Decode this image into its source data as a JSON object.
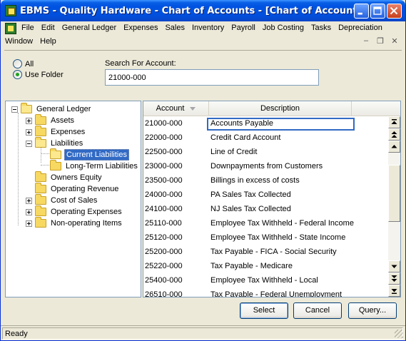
{
  "window": {
    "title": "EBMS - Quality Hardware - Chart of Accounts - [Chart of Accounts]"
  },
  "menu": {
    "row1": [
      "File",
      "Edit",
      "General Ledger",
      "Expenses",
      "Sales",
      "Inventory",
      "Payroll",
      "Job Costing",
      "Tasks",
      "Depreciation"
    ],
    "row2": [
      "Window",
      "Help"
    ]
  },
  "search": {
    "radio_all": "All",
    "radio_use_folder": "Use Folder",
    "label": "Search For Account:",
    "value": "21000-000"
  },
  "tree": {
    "root": "General Ledger",
    "items": [
      {
        "label": "Assets"
      },
      {
        "label": "Expenses"
      },
      {
        "label": "Liabilities"
      },
      {
        "label": "Current Liabilities"
      },
      {
        "label": "Long-Term Liabilities"
      },
      {
        "label": "Owners Equity"
      },
      {
        "label": "Operating Revenue"
      },
      {
        "label": "Cost of Sales"
      },
      {
        "label": "Operating Expenses"
      },
      {
        "label": "Non-operating Items"
      }
    ]
  },
  "grid": {
    "columns": [
      "Account",
      "Description"
    ],
    "rows": [
      [
        "21000-000",
        "Accounts Payable"
      ],
      [
        "22000-000",
        "Credit Card Account"
      ],
      [
        "22500-000",
        "Line of Credit"
      ],
      [
        "23000-000",
        "Downpayments from Customers"
      ],
      [
        "23500-000",
        "Billings in excess of costs"
      ],
      [
        "24000-000",
        "PA Sales Tax Collected"
      ],
      [
        "24100-000",
        "NJ Sales Tax Collected"
      ],
      [
        "25110-000",
        "Employee Tax Withheld - Federal Income"
      ],
      [
        "25120-000",
        "Employee Tax Withheld - State Income"
      ],
      [
        "25200-000",
        "Tax Payable - FICA - Social Security"
      ],
      [
        "25220-000",
        "Tax Payable - Medicare"
      ],
      [
        "25400-000",
        "Employee Tax Withheld - Local"
      ],
      [
        "26510-000",
        "Tax Payable - Federal Unemployment"
      ]
    ]
  },
  "buttons": {
    "select": "Select",
    "cancel": "Cancel",
    "query": "Query..."
  },
  "status": {
    "text": "Ready"
  },
  "colors": {
    "title_bar": "#0053e1",
    "selection": "#316ac5"
  }
}
